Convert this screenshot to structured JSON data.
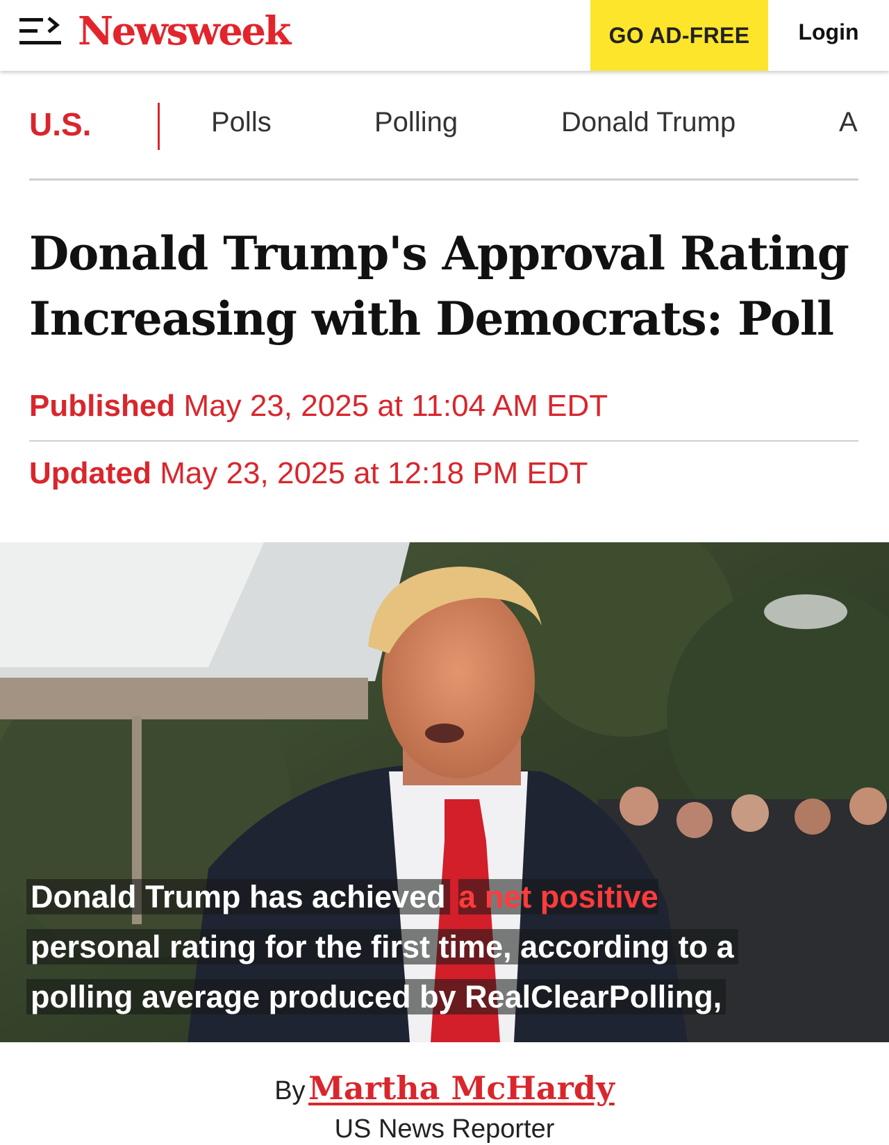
{
  "header": {
    "menu_icon": "menu-arrow-icon",
    "logo_text": "Newsweek",
    "ad_free_label": "GO AD-FREE",
    "login_label": "Login",
    "colors": {
      "brand": "#e2252c",
      "ad_free_bg": "#fde52b"
    }
  },
  "section_nav": {
    "current": "U.S.",
    "links": [
      "Polls",
      "Polling",
      "Donald Trump",
      "A"
    ]
  },
  "article": {
    "headline_line1": "Donald Trump's Approval Rating",
    "headline_line2": "Increasing with Democrats: Poll",
    "published_label": "Published",
    "published_value": "May 23, 2025 at 11:04 AM EDT",
    "updated_label": "Updated",
    "updated_value": "May 23, 2025 at 12:18 PM EDT"
  },
  "hero": {
    "caption_line1_start": "Donald Trump has achieved",
    "caption_line1_highlight": "a net positive",
    "caption_line2": "personal rating for the first time, according to a",
    "caption_line3": "polling average produced by RealClearPolling,"
  },
  "byline": {
    "by_label": "By",
    "author": "Martha McHardy",
    "role": "US News Reporter"
  }
}
